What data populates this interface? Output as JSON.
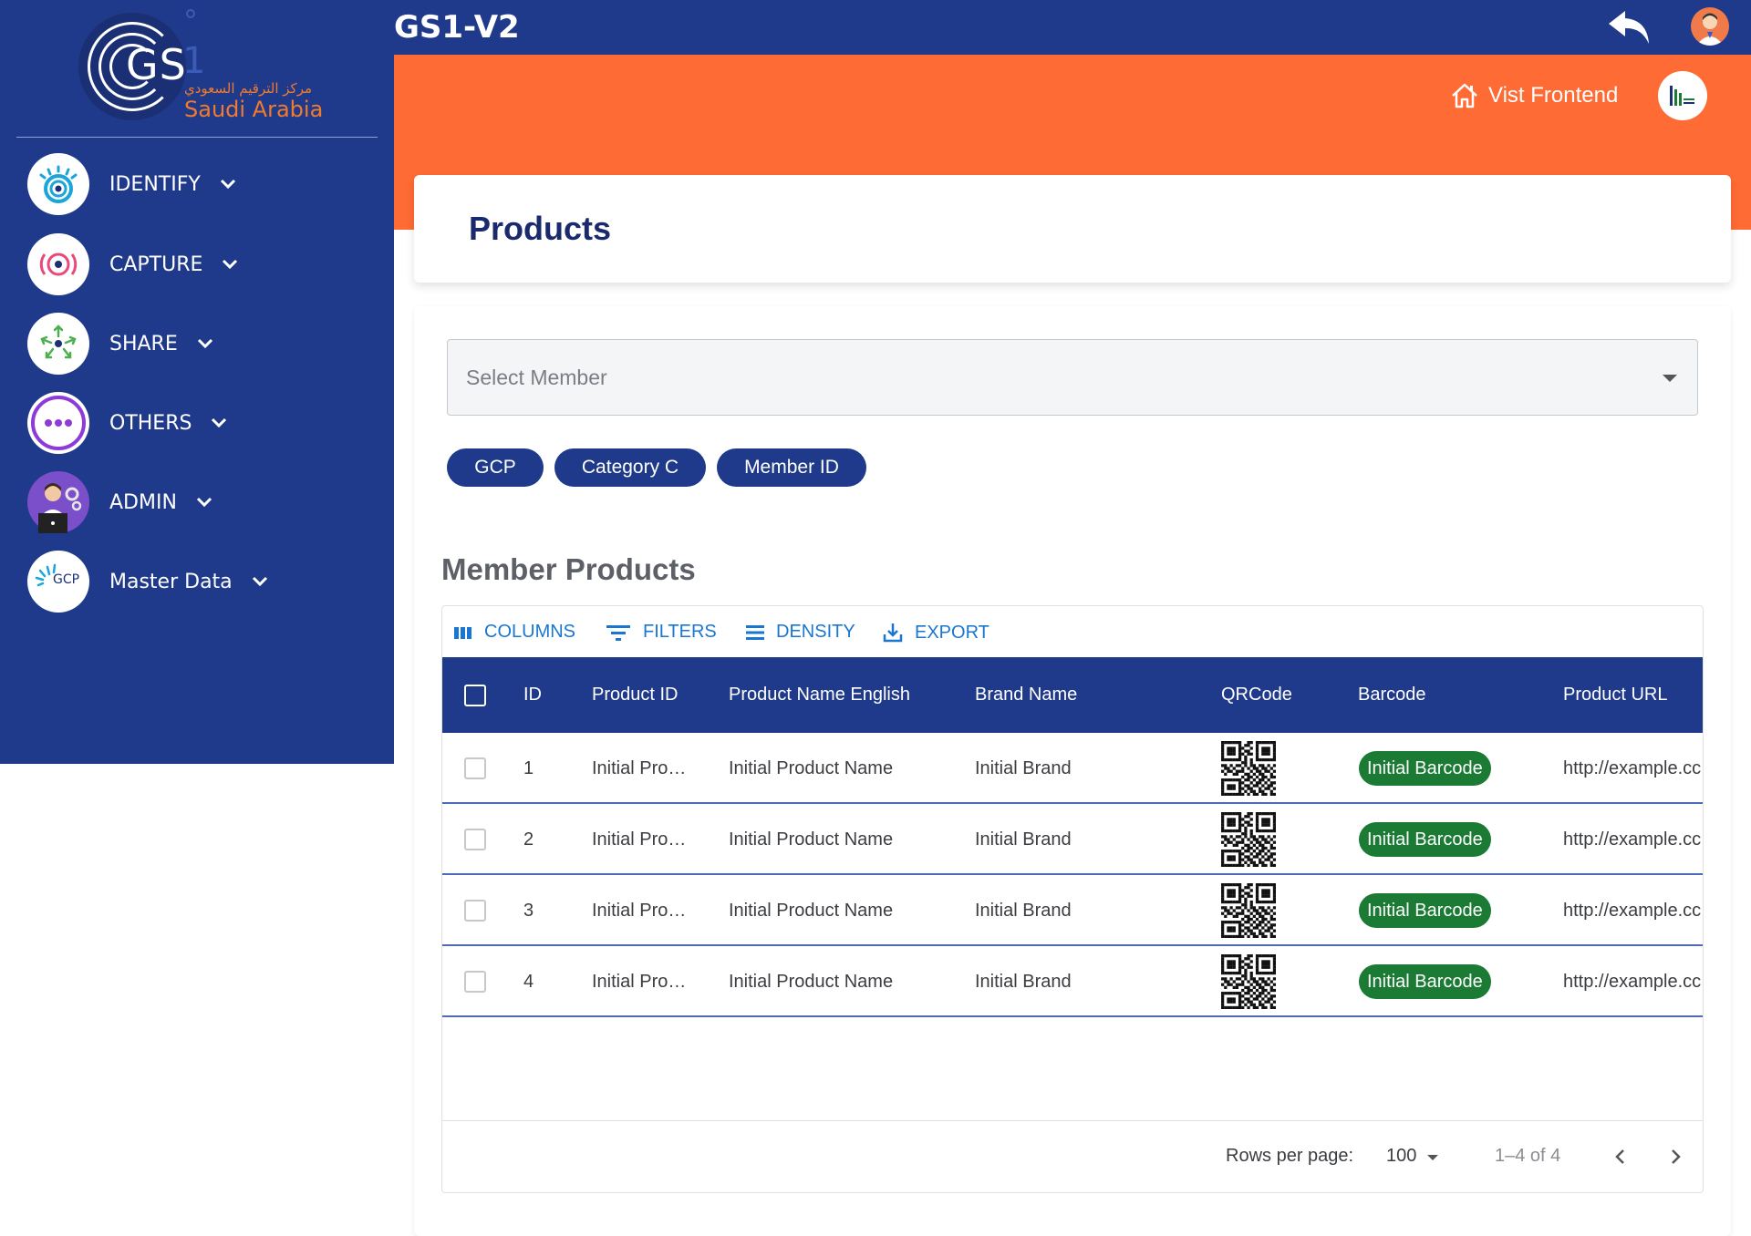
{
  "brand": {
    "logo_mark": "GS",
    "logo_one": "1",
    "logo_arabic": "مركز الترقيم السعودي",
    "logo_country": "Saudi Arabia"
  },
  "app_title": "GS1-V2",
  "sidebar": {
    "items": [
      {
        "label": "IDENTIFY",
        "icon": "identify-eye-icon"
      },
      {
        "label": "CAPTURE",
        "icon": "capture-target-icon"
      },
      {
        "label": "SHARE",
        "icon": "share-network-icon"
      },
      {
        "label": "OTHERS",
        "icon": "more-dots-icon"
      },
      {
        "label": "ADMIN",
        "icon": "admin-user-icon"
      },
      {
        "label": "Master Data",
        "icon": "gcp-master-data-icon"
      }
    ],
    "gcp_badge": "GCP"
  },
  "header": {
    "visit_label": "Vist Frontend",
    "back_icon": "undo-arrow-icon",
    "avatar_icon": "user-avatar-icon"
  },
  "page": {
    "title": "Products"
  },
  "filters": {
    "select_placeholder": "Select Member",
    "chips": [
      "GCP",
      "Category C",
      "Member ID"
    ]
  },
  "section_title": "Member Products",
  "toolbar": {
    "columns": "COLUMNS",
    "filters": "FILTERS",
    "density": "DENSITY",
    "export": "EXPORT"
  },
  "table": {
    "columns": [
      "ID",
      "Product ID",
      "Product Name English",
      "Brand Name",
      "QRCode",
      "Barcode",
      "Product URL"
    ],
    "rows": [
      {
        "id": "1",
        "product_id": "Initial Pro…",
        "name": "Initial Product Name",
        "brand": "Initial Brand",
        "barcode": "Initial Barcode",
        "url": "http://example.cc"
      },
      {
        "id": "2",
        "product_id": "Initial Pro…",
        "name": "Initial Product Name",
        "brand": "Initial Brand",
        "barcode": "Initial Barcode",
        "url": "http://example.cc"
      },
      {
        "id": "3",
        "product_id": "Initial Pro…",
        "name": "Initial Product Name",
        "brand": "Initial Brand",
        "barcode": "Initial Barcode",
        "url": "http://example.cc"
      },
      {
        "id": "4",
        "product_id": "Initial Pro…",
        "name": "Initial Product Name",
        "brand": "Initial Brand",
        "barcode": "Initial Barcode",
        "url": "http://example.cc"
      }
    ]
  },
  "pagination": {
    "rows_per_page_label": "Rows per page:",
    "rows_per_page_value": "100",
    "range": "1–4 of 4"
  },
  "colors": {
    "navy": "#203a8b",
    "orange": "#ff6b35",
    "chip": "#1f3a8a",
    "barcode_green": "#1b7a34",
    "link_blue": "#1976d2"
  }
}
